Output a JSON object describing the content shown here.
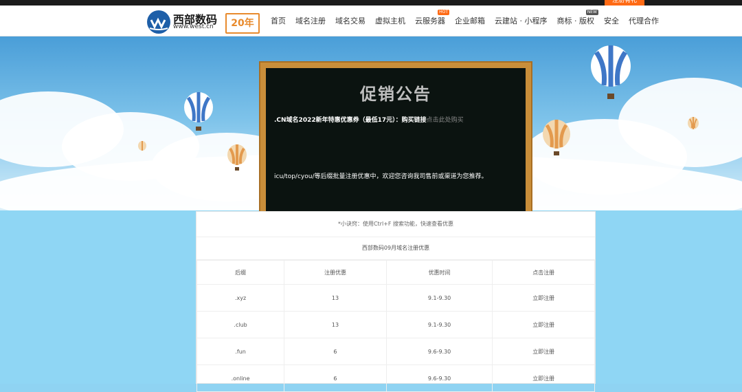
{
  "header": {
    "register_label": "注册有礼",
    "logo_cn": "西部数码",
    "logo_en": "www.west.cn",
    "anniversary": "20年",
    "nav": [
      {
        "label": "首页"
      },
      {
        "label": "域名注册"
      },
      {
        "label": "域名交易"
      },
      {
        "label": "虚拟主机"
      },
      {
        "label": "云服务器",
        "badge": "HOT",
        "chevron": "▾"
      },
      {
        "label": "企业邮箱"
      },
      {
        "label": "云建站 · 小程序"
      },
      {
        "label": "商标 · 版权",
        "badge": "NEW"
      },
      {
        "label": "安全"
      },
      {
        "label": "代理合作"
      }
    ]
  },
  "board": {
    "title": "促销公告",
    "line1_text": ".CN域名2022新年特惠优惠券（最低17元）：",
    "line1_link": "购买链接",
    "line1_click": "点击此处购买",
    "line2_text": "icu/top/cyou/等后缀批量注册优惠中，欢迎您咨询我司售前或渠道为您推荐。"
  },
  "promo": {
    "tip": "*小诀窍：使用Ctrl+F 搜索功能，快速查看优惠",
    "caption": "西部数码09月域名注册优惠",
    "columns": [
      "后缀",
      "注册优惠",
      "优惠时间",
      "点击注册"
    ],
    "rows": [
      {
        "suffix": ".xyz",
        "price": "13",
        "period": "9.1-9.30",
        "action": "立即注册"
      },
      {
        "suffix": ".club",
        "price": "13",
        "period": "9.1-9.30",
        "action": "立即注册"
      },
      {
        "suffix": ".fun",
        "price": "6",
        "period": "9.6-9.30",
        "action": "立即注册"
      },
      {
        "suffix": ".online",
        "price": "6",
        "period": "9.6-9.30",
        "action": "立即注册"
      }
    ]
  },
  "colors": {
    "accent": "#ff6a14",
    "board_frame": "#c98e3a",
    "board": "#0b1310",
    "sky": "#7ec3ea"
  }
}
